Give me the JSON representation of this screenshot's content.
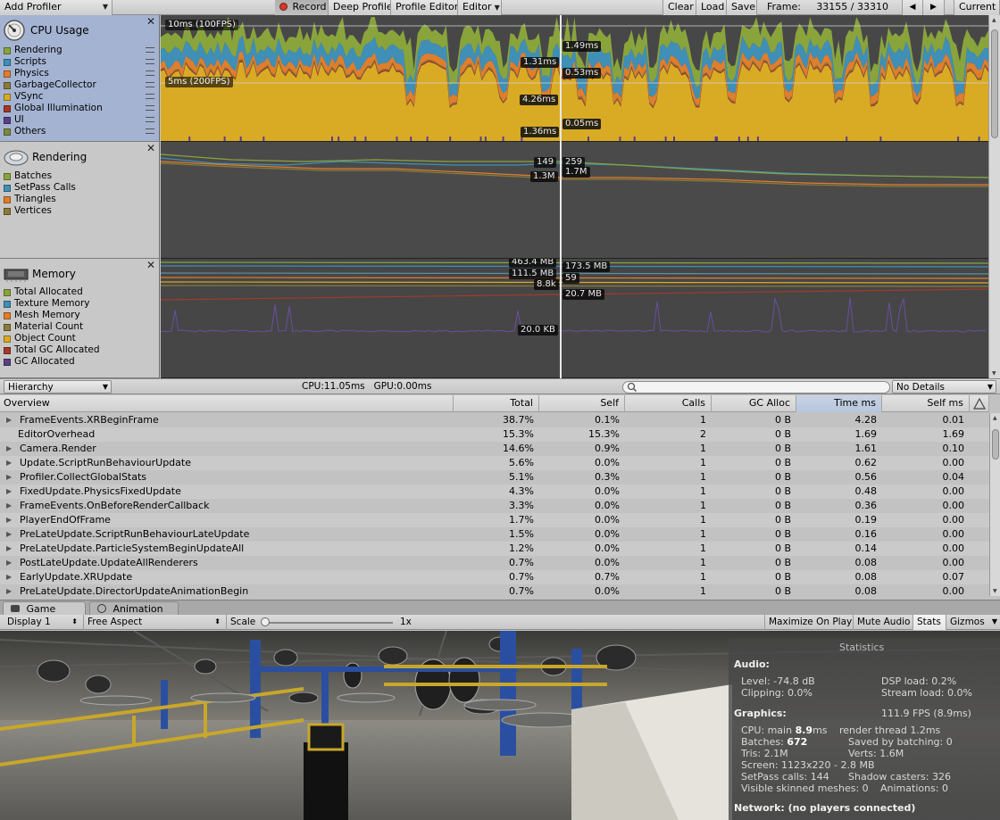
{
  "toolbar": {
    "add_profiler": "Add Profiler",
    "record": "Record",
    "deep_profile": "Deep Profile",
    "profile_editor": "Profile Editor",
    "editor": "Editor",
    "clear": "Clear",
    "load": "Load",
    "save": "Save",
    "frame_label": "Frame:",
    "frame_value": "33155 / 33310",
    "prev": "◀",
    "next": "▶",
    "current": "Current"
  },
  "cpu_panel": {
    "title": "CPU Usage",
    "legend": [
      {
        "label": "Rendering",
        "color": "#8aa43c"
      },
      {
        "label": "Scripts",
        "color": "#3f8fb7"
      },
      {
        "label": "Physics",
        "color": "#e07e2c"
      },
      {
        "label": "GarbageCollector",
        "color": "#8b7a3a"
      },
      {
        "label": "VSync",
        "color": "#d9ab24"
      },
      {
        "label": "Global Illumination",
        "color": "#a33a2a"
      },
      {
        "label": "UI",
        "color": "#5a3f85"
      },
      {
        "label": "Others",
        "color": "#7c8a3a"
      }
    ],
    "ref_top": "10ms (100FPS)",
    "ref_mid": "5ms (200FPS)",
    "values_left": [
      "1.31ms",
      "4.26ms",
      "1.36ms"
    ],
    "values_right": [
      "1.49ms",
      "0.53ms",
      "0.05ms"
    ]
  },
  "rendering_panel": {
    "title": "Rendering",
    "legend": [
      {
        "label": "Batches",
        "color": "#8aa43c"
      },
      {
        "label": "SetPass Calls",
        "color": "#3f8fb7"
      },
      {
        "label": "Triangles",
        "color": "#e07e2c"
      },
      {
        "label": "Vertices",
        "color": "#8b7a3a"
      }
    ],
    "values_left": [
      "149",
      "1.3M"
    ],
    "values_right": [
      "259",
      "1.7M"
    ]
  },
  "memory_panel": {
    "title": "Memory",
    "legend": [
      {
        "label": "Total Allocated",
        "color": "#8aa43c"
      },
      {
        "label": "Texture Memory",
        "color": "#3f8fb7"
      },
      {
        "label": "Mesh Memory",
        "color": "#e07e2c"
      },
      {
        "label": "Material Count",
        "color": "#8b7a3a"
      },
      {
        "label": "Object Count",
        "color": "#d9ab24"
      },
      {
        "label": "Total GC Allocated",
        "color": "#a33a2a"
      },
      {
        "label": "GC Allocated",
        "color": "#5a3f85"
      }
    ],
    "values_left": [
      "463.4 MB",
      "111.5 MB",
      "8.8k",
      "20.0 KB"
    ],
    "values_right": [
      "173.5 MB",
      "59",
      "20.7 MB"
    ]
  },
  "hierarchy_bar": {
    "view_mode": "Hierarchy",
    "cpu_gpu": "CPU:11.05ms   GPU:0.00ms",
    "details": "No Details"
  },
  "table": {
    "columns": [
      "Overview",
      "Total",
      "Self",
      "Calls",
      "GC Alloc",
      "Time ms",
      "Self ms"
    ],
    "rows": [
      {
        "name": "FrameEvents.XRBeginFrame",
        "total": "38.7%",
        "self": "0.1%",
        "calls": "1",
        "gc": "0 B",
        "time": "4.28",
        "selfms": "0.01",
        "fold": true
      },
      {
        "name": "EditorOverhead",
        "total": "15.3%",
        "self": "15.3%",
        "calls": "2",
        "gc": "0 B",
        "time": "1.69",
        "selfms": "1.69",
        "fold": false
      },
      {
        "name": "Camera.Render",
        "total": "14.6%",
        "self": "0.9%",
        "calls": "1",
        "gc": "0 B",
        "time": "1.61",
        "selfms": "0.10",
        "fold": true
      },
      {
        "name": "Update.ScriptRunBehaviourUpdate",
        "total": "5.6%",
        "self": "0.0%",
        "calls": "1",
        "gc": "0 B",
        "time": "0.62",
        "selfms": "0.00",
        "fold": true
      },
      {
        "name": "Profiler.CollectGlobalStats",
        "total": "5.1%",
        "self": "0.3%",
        "calls": "1",
        "gc": "0 B",
        "time": "0.56",
        "selfms": "0.04",
        "fold": true
      },
      {
        "name": "FixedUpdate.PhysicsFixedUpdate",
        "total": "4.3%",
        "self": "0.0%",
        "calls": "1",
        "gc": "0 B",
        "time": "0.48",
        "selfms": "0.00",
        "fold": true
      },
      {
        "name": "FrameEvents.OnBeforeRenderCallback",
        "total": "3.3%",
        "self": "0.0%",
        "calls": "1",
        "gc": "0 B",
        "time": "0.36",
        "selfms": "0.00",
        "fold": true
      },
      {
        "name": "PlayerEndOfFrame",
        "total": "1.7%",
        "self": "0.0%",
        "calls": "1",
        "gc": "0 B",
        "time": "0.19",
        "selfms": "0.00",
        "fold": true
      },
      {
        "name": "PreLateUpdate.ScriptRunBehaviourLateUpdate",
        "total": "1.5%",
        "self": "0.0%",
        "calls": "1",
        "gc": "0 B",
        "time": "0.16",
        "selfms": "0.00",
        "fold": true
      },
      {
        "name": "PreLateUpdate.ParticleSystemBeginUpdateAll",
        "total": "1.2%",
        "self": "0.0%",
        "calls": "1",
        "gc": "0 B",
        "time": "0.14",
        "selfms": "0.00",
        "fold": true
      },
      {
        "name": "PostLateUpdate.UpdateAllRenderers",
        "total": "0.7%",
        "self": "0.0%",
        "calls": "1",
        "gc": "0 B",
        "time": "0.08",
        "selfms": "0.00",
        "fold": true
      },
      {
        "name": "EarlyUpdate.XRUpdate",
        "total": "0.7%",
        "self": "0.7%",
        "calls": "1",
        "gc": "0 B",
        "time": "0.08",
        "selfms": "0.07",
        "fold": true
      },
      {
        "name": "PreLateUpdate.DirectorUpdateAnimationBegin",
        "total": "0.7%",
        "self": "0.0%",
        "calls": "1",
        "gc": "0 B",
        "time": "0.08",
        "selfms": "0.00",
        "fold": true
      }
    ]
  },
  "tabs": {
    "game": "Game",
    "animation": "Animation"
  },
  "game_bar": {
    "display": "Display 1",
    "aspect": "Free Aspect",
    "scale_label": "Scale",
    "scale_value": "1x",
    "maximize": "Maximize On Play",
    "mute": "Mute Audio",
    "stats": "Stats",
    "gizmos": "Gizmos"
  },
  "stats": {
    "title": "Statistics",
    "audio_header": "Audio:",
    "level": "Level: -74.8 dB",
    "clipping": "Clipping: 0.0%",
    "dsp": "DSP load: 0.2%",
    "stream": "Stream load: 0.0%",
    "graphics_header": "Graphics:",
    "fps": "111.9 FPS (8.9ms)",
    "cpu_main_label": "CPU: main ",
    "cpu_main_value": "8.9",
    "cpu_main_unit": "ms",
    "render_thread": "render thread 1.2ms",
    "batches_label": "Batches: ",
    "batches_value": "672",
    "saved_batching": "Saved by batching: 0",
    "tris": "Tris: 2.1M",
    "verts": "Verts: 1.6M",
    "screen": "Screen: 1123x220 - 2.8 MB",
    "setpass": "SetPass calls: 144",
    "shadow": "Shadow casters: 326",
    "skinned": "Visible skinned meshes: 0",
    "animations": "Animations: 0",
    "network": "Network: (no players connected)"
  }
}
